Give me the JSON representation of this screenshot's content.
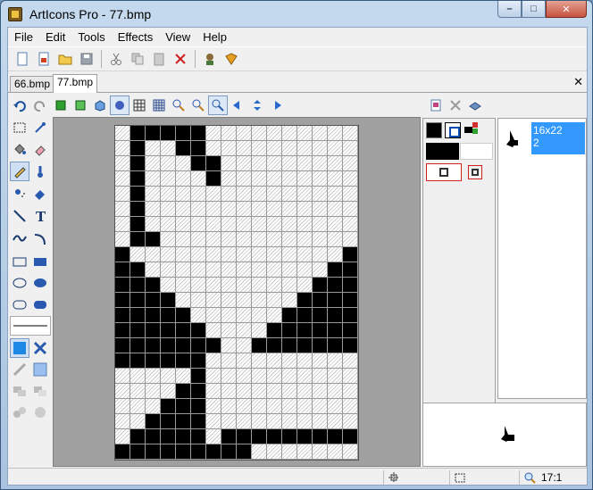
{
  "window": {
    "title": "ArtIcons Pro - 77.bmp",
    "min_glyph": "–",
    "max_glyph": "□",
    "close_glyph": "✕"
  },
  "menu": [
    "File",
    "Edit",
    "Tools",
    "Effects",
    "View",
    "Help"
  ],
  "tabs": [
    {
      "label": "66.bmp",
      "active": false
    },
    {
      "label": "77.bmp",
      "active": true
    }
  ],
  "tab_close_glyph": "✕",
  "icon_list": {
    "size": "16x22",
    "count": "2"
  },
  "status": {
    "zoom": "17:1"
  },
  "image_grid": {
    "columns": 16,
    "rows": 22,
    "pixels": [
      "TBBBBBTTTTTTTTTT",
      "TBTTBBTTTTTTTTTT",
      "TBTTTBBTTTTTTTTT",
      "TBTTTTBTTTTTTTTT",
      "TBTTTTTTTTTTTTTT",
      "TBTTTTTTTTTTTTTT",
      "TBTTTTTTTTTTTTTT",
      "TBBTTTTTTTTTTTTT",
      "BTTTTTTTTTTTTTTB",
      "BBTTTTTTTTTTTTBB",
      "BBBTTTTTTTTTTBBB",
      "BBBBTTTTTTTTBBBB",
      "BBBBBTTTTTTBBBBB",
      "BBBBBBTTTTBBBBBB",
      "BBBBBBBTTBBBBBBB",
      "BBBBBBTTTTTTTTTT",
      "TTTTTBTTTTTTTTTT",
      "TTTTBBTTTTTTTTTT",
      "TTTBBBTTTTTTTTTT",
      "TTBBBBTTTTTTTTTT",
      "TBBBBBTBBBBBBBBB",
      "BBBBBBBBBTTTTTTT"
    ]
  },
  "colors": {
    "foreground": "#000000",
    "background": "#ffffff",
    "selection": "#3399ff"
  }
}
